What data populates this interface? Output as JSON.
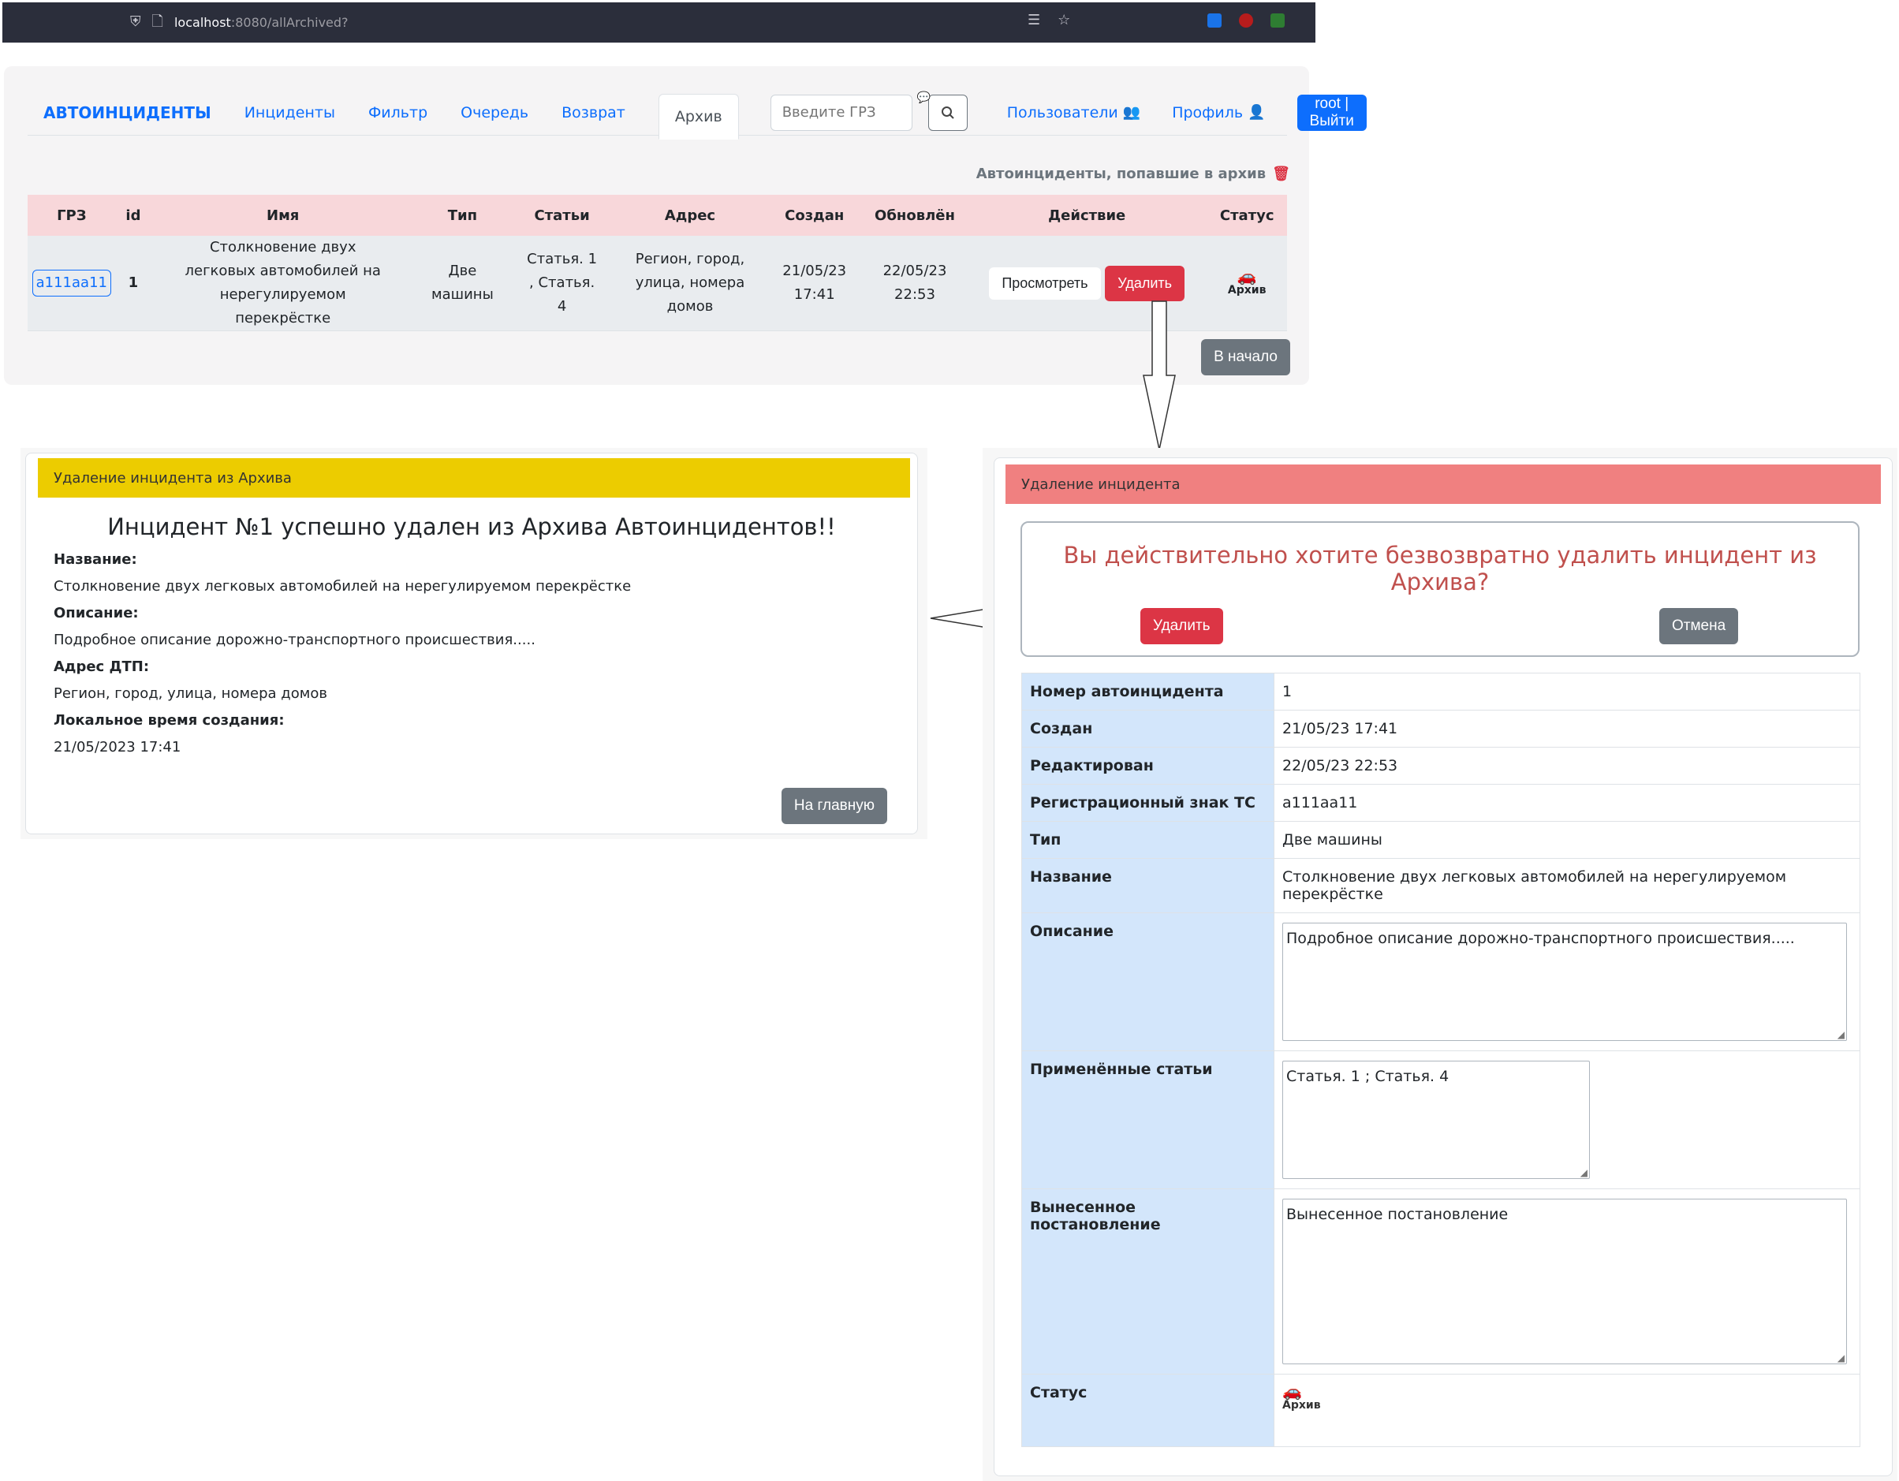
{
  "browser": {
    "url_host": "localhost",
    "url_rest": ":8080/allArchived?"
  },
  "nav": {
    "brand": "АВТОИНЦИДЕНТЫ",
    "links": [
      "Инциденты",
      "Фильтр",
      "Очередь",
      "Возврат"
    ],
    "active": "Архив",
    "search_placeholder": "Введите ГРЗ",
    "users": "Пользователи",
    "profile": "Профиль",
    "logout": "root |Выйти"
  },
  "archive_caption": "Автоинциденты, попавшие в архив",
  "table": {
    "headers": [
      "ГРЗ",
      "id",
      "Имя",
      "Тип",
      "Статьи",
      "Адрес",
      "Создан",
      "Обновлён",
      "Действие",
      "Статус"
    ],
    "row": {
      "grz": "a111aa11",
      "id": "1",
      "name": "Столкновение двух легковых автомобилей на нерегулируемом перекрёстке",
      "type": "Две машины",
      "articles": "Статья. 1 , Статья. 4",
      "address": "Регион, город, улица, номера домов",
      "created": "21/05/23 17:41",
      "updated": "22/05/23 22:53",
      "view_btn": "Просмотреть",
      "delete_btn": "Удалить",
      "status": "Архив"
    }
  },
  "home_top_btn": "В начало",
  "result_card": {
    "header": "Удаление инцидента из Архива",
    "title": "Инцидент №1 успешно удален из Архива Автоинцидентов!!",
    "name_label": "Название:",
    "name_value": "Столкновение двух легковых автомобилей на нерегулируемом перекрёстке",
    "desc_label": "Описание:",
    "desc_value": "Подробное описание дорожно-транспортного происшествия.....",
    "addr_label": "Адрес ДТП:",
    "addr_value": "Регион, город, улица, номера домов",
    "time_label": "Локальное время создания:",
    "time_value": "21/05/2023 17:41",
    "home_btn": "На главную"
  },
  "confirm_card": {
    "header": "Удаление инцидента",
    "question": "Вы действительно хотите безвозвратно удалить инцидент из Архива?",
    "delete_btn": "Удалить",
    "cancel_btn": "Отмена",
    "rows": {
      "number_k": "Номер автоинцидента",
      "number_v": "1",
      "created_k": "Создан",
      "created_v": "21/05/23 17:41",
      "edited_k": "Редактирован",
      "edited_v": "22/05/23 22:53",
      "plate_k": "Регистрационный знак ТС",
      "plate_v": "a111aa11",
      "type_k": "Тип",
      "type_v": "Две машины",
      "name_k": "Название",
      "name_v": "Столкновение двух легковых автомобилей на нерегулируемом перекрёстке",
      "desc_k": "Описание",
      "desc_v": "Подробное описание дорожно-транспортного происшествия.....",
      "articles_k": "Применённые статьи",
      "articles_v": "Статья. 1 ; Статья. 4",
      "decision_k": "Вынесенное постановление",
      "decision_v": "Вынесенное постановление",
      "status_k": "Статус",
      "status_v": "Архив"
    }
  },
  "colors": {
    "primary": "#0d6efd",
    "danger": "#dc3545",
    "secondary": "#6c757d",
    "yellow_header": "#eccc00",
    "red_header": "#f08080",
    "table_head": "#f8d7da"
  },
  "icons": [
    "shield-icon",
    "page-icon",
    "reader-icon",
    "star-icon",
    "users-icon",
    "user-icon",
    "search-icon",
    "trash-icon",
    "car-icon",
    "chat-icon"
  ]
}
